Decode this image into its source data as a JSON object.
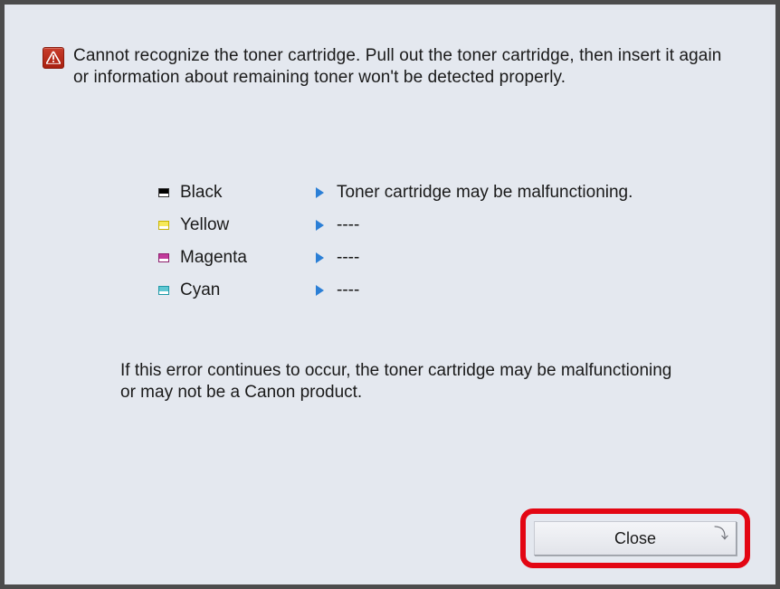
{
  "message": {
    "line1": "Cannot recognize the toner cartridge. Pull out the toner cartridge, then insert it again",
    "line2": "or information about remaining toner won't be detected properly."
  },
  "toners": [
    {
      "swatch": "black",
      "name": "Black",
      "status": "Toner cartridge may be malfunctioning."
    },
    {
      "swatch": "yellow",
      "name": "Yellow",
      "status": "----"
    },
    {
      "swatch": "magenta",
      "name": "Magenta",
      "status": "----"
    },
    {
      "swatch": "cyan",
      "name": "Cyan",
      "status": "----"
    }
  ],
  "footer": {
    "line1": "If this error continues to occur, the toner cartridge may be malfunctioning",
    "line2": "or may not be a Canon product."
  },
  "buttons": {
    "close": "Close"
  }
}
